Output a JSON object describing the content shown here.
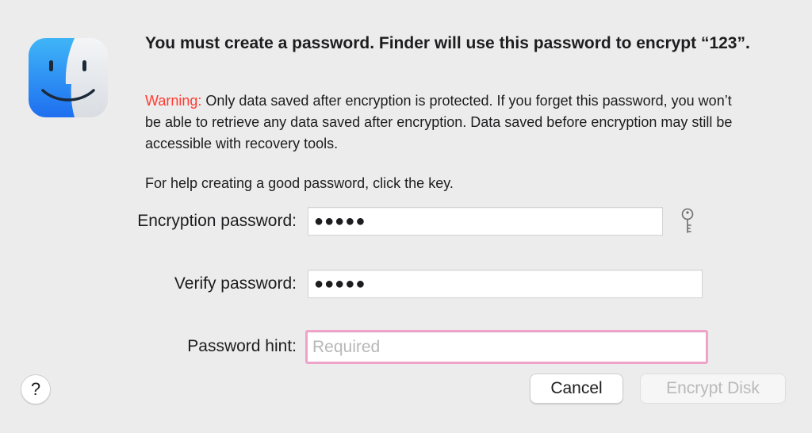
{
  "dialog": {
    "headline": "You must create a password. Finder will use this password to encrypt “123”.",
    "warning_label": "Warning:",
    "warning_text": " Only data saved after encryption is protected. If you forget this password, you won’t be able to retrieve any data saved after encryption. Data saved before encryption may still be accessible with recovery tools.",
    "help_text": "For help creating a good password, click the key.",
    "app_icon": "finder-icon"
  },
  "form": {
    "encryption_password_label": "Encryption password:",
    "encryption_password_value": "●●●●●",
    "verify_password_label": "Verify password:",
    "verify_password_value": "●●●●●",
    "password_hint_label": "Password hint:",
    "password_hint_value": "",
    "password_hint_placeholder": "Required",
    "key_icon": "key-icon"
  },
  "buttons": {
    "help_label": "?",
    "cancel_label": "Cancel",
    "encrypt_label": "Encrypt Disk"
  },
  "colors": {
    "warning": "#ff3b30",
    "focus_ring": "#f0a3c8",
    "background": "#ececec"
  }
}
